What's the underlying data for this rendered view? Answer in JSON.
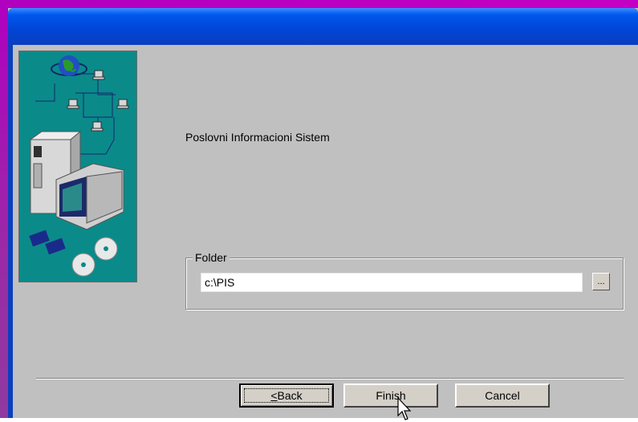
{
  "window": {
    "app_title": "Poslovni Informacioni Sistem"
  },
  "folder_group": {
    "legend": "Folder",
    "path_value": "c:\\PIS",
    "browse_label": "..."
  },
  "buttons": {
    "back_label": "Back",
    "back_mnemonic": "<",
    "finish_label": "Finish",
    "cancel_label": "Cancel"
  },
  "colors": {
    "titlebar": "#0058ee",
    "dialog_face": "#c0c0c0",
    "side_image_bg": "#0b8a8a",
    "desktop": "#b000c0"
  },
  "icons": {
    "side_image": "network-computer-illustration",
    "cursor": "mouse-pointer-icon"
  }
}
